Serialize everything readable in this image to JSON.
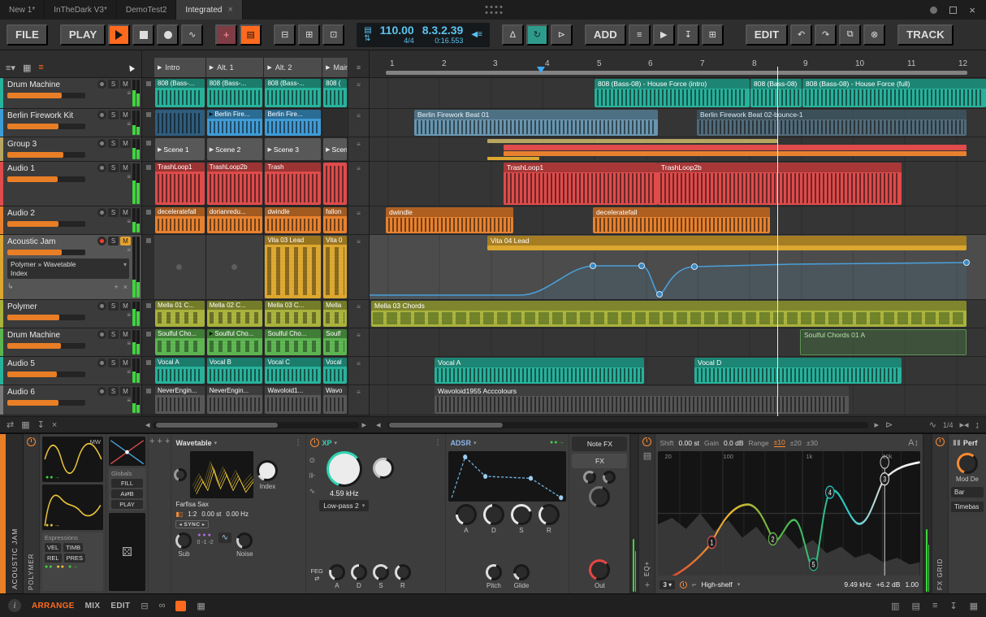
{
  "palette": {
    "accent": "#ff6a1e",
    "slider": "#e87e26",
    "teal": "#27b29b",
    "blue": "#3e9bd6",
    "lightblue": "#7ab7d8",
    "red": "#e04b4b",
    "orange": "#e8812e",
    "yellow": "#dca72f",
    "olive": "#a8b23c",
    "green": "#5cb450",
    "grayclip": "#5c5c5c",
    "darkclip": "#565656",
    "dispblue": "#5cc3f0",
    "meter": "#3fd43f",
    "autocurve": "#4a9fd8"
  },
  "titlebar": {
    "tabs": [
      "New 1*",
      "InTheDark V3*",
      "DemoTest2",
      "Integrated"
    ],
    "close": "×"
  },
  "toolbar": {
    "file": "FILE",
    "play": "PLAY",
    "tempo": "110.00",
    "time_sig": "4/4",
    "position": "8.3.2.39",
    "time": "0:16.553",
    "add": "ADD",
    "edit": "EDIT",
    "track": "TRACK"
  },
  "labels": {
    "solo": "S",
    "mute": "M"
  },
  "scenes": [
    "Intro",
    "Alt. 1",
    "Alt. 2",
    "Main"
  ],
  "ruler": [
    "1",
    "2",
    "3",
    "4",
    "5",
    "6",
    "7",
    "8",
    "9",
    "10",
    "11",
    "12"
  ],
  "tracks": [
    {
      "name": "Drum Machine"
    },
    {
      "name": "Berlin Firework Kit"
    },
    {
      "name": "Group 3"
    },
    {
      "name": "Audio 1"
    },
    {
      "name": "Audio 2"
    },
    {
      "name": "Acoustic Jam",
      "chain1": "Polymer » Wavetable",
      "chain2": "Index"
    },
    {
      "name": "Polymer"
    },
    {
      "name": "Drum Machine"
    },
    {
      "name": "Audio 5"
    },
    {
      "name": "Audio 6"
    }
  ],
  "launcher": {
    "r0": [
      "808 (Bass-...",
      "808 (Bass-...",
      "808 (Bass-...",
      "808 ("
    ],
    "r1": [
      "",
      "Berlin Fire...",
      "Berlin Fire...",
      ""
    ],
    "r2": [
      "Scene 1",
      "Scene 2",
      "Scene 3",
      "Scen"
    ],
    "r3": [
      "TrashLoop1",
      "TrashLoop2b",
      "Trash",
      ""
    ],
    "r4": [
      "deceleratefall",
      "dorianredu...",
      "dwindle",
      "fallon"
    ],
    "r5": [
      "",
      "",
      "Vita 03 Lead",
      "Vita 0"
    ],
    "r6": [
      "Mella 01 C...",
      "Mella 02 C...",
      "Mella 03 C...",
      "Mella"
    ],
    "r7": [
      "Soulful Cho...",
      "Soulful Cho...",
      "Soulful Cho...",
      "Soulf"
    ],
    "r8": [
      "Vocal A",
      "Vocal B",
      "Vocal C",
      "Vocal"
    ],
    "r9": [
      "NeverEngin...",
      "NeverEngin...",
      "Wavoloid1...",
      "Wavo"
    ]
  },
  "arranger": {
    "r0": [
      "808 (Bass-08) - House Force (intro)",
      "808 (Bass-08)",
      "808 (Bass-08) - House Force (full)"
    ],
    "r1": [
      "Berlin Firework Beat 01",
      "Berlin Firework Beat 02-bounce-1"
    ],
    "r3": [
      "TrashLoop1",
      "TrashLoop2b"
    ],
    "r4": [
      "dwindle",
      "deceleratefall"
    ],
    "r5": [
      "Vita 04 Lead"
    ],
    "r6": [
      "Mella 03 Chords"
    ],
    "r7": [
      "Soulful Chords 01 A"
    ],
    "r8": [
      "Vocal A",
      "Vocal D"
    ],
    "r9": [
      "Wavoloid1955 Acccolours"
    ]
  },
  "scrollrow": {
    "zoom": "1/4"
  },
  "device": {
    "track_label": "ACOUSTIC JAM",
    "polymer": {
      "name": "POLYMER",
      "mw": "MW",
      "globals_title": "Globals",
      "fill": "FILL",
      "ab": "A⇄B",
      "play": "PLAY",
      "expr_title": "Expressions",
      "vel": "VEL",
      "timb": "TIMB",
      "rel": "REL",
      "pres": "PRES",
      "wt_header": "Wavetable",
      "preset": "Farfisa Sax",
      "index": "Index",
      "ratio": "1:2",
      "semi": "0.00 st",
      "hz": "0.00 Hz",
      "sync": "SYNC",
      "sub": "Sub",
      "octaves": "0 -1 -2",
      "noise": "Noise",
      "filter_header": "XP",
      "cutoff": "4.59 kHz",
      "filter_type": "Low-pass 2",
      "feg": "FEG",
      "env_header": "ADSR",
      "a": "A",
      "d": "D",
      "s": "S",
      "r": "R",
      "notefx_tab": "Note FX",
      "fx_tab": "FX",
      "pitch": "Pitch",
      "glide": "Glide",
      "out": "Out"
    },
    "eq": {
      "label": "EQ+",
      "shift_label": "Shift",
      "shift_value": "0.00 st",
      "gain_label": "Gain",
      "gain_value": "0.0 dB",
      "range_label": "Range",
      "range_options": [
        "±10",
        "±20",
        "±30"
      ],
      "freq_labels": [
        "20",
        "100",
        "1k",
        "10k"
      ],
      "nodes": [
        "1",
        "2",
        "3",
        "4",
        "5"
      ],
      "band_index": "3",
      "band_type": "High-shelf",
      "band_freq": "9.49 kHz",
      "band_gain": "+6.2 dB",
      "band_q": "1.00"
    },
    "fxgrid": {
      "label": "FX GRID",
      "perf": "Perf",
      "mod": "Mod De",
      "bar": "Bar",
      "timebase": "Timebas"
    }
  },
  "statusbar": {
    "arrange": "ARRANGE",
    "mix": "MIX",
    "edit": "EDIT"
  }
}
